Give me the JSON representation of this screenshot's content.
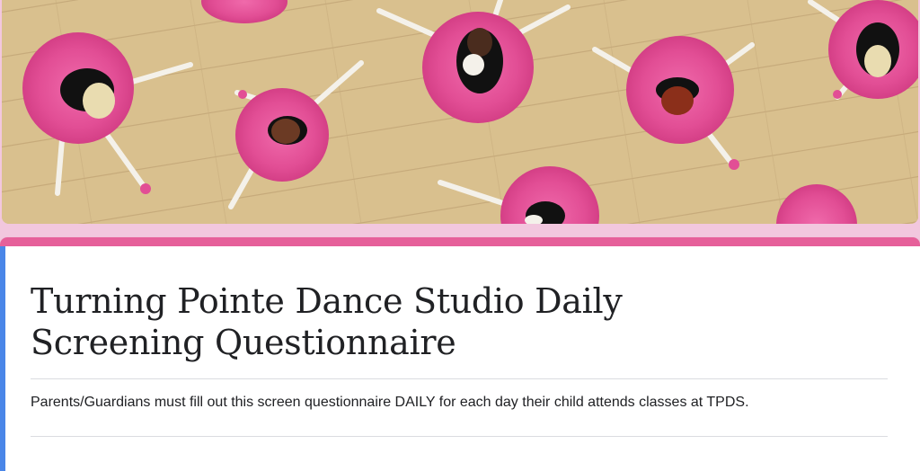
{
  "form": {
    "title": "Turning Pointe Dance Studio Daily Screening Questionnaire",
    "description": "Parents/Guardians must fill out this screen questionnaire DAILY for each day their child attends classes at TPDS."
  },
  "header_image": {
    "subject": "ballerinas in pink tutus on a wooden floor",
    "icon": "header-illustration"
  },
  "colors": {
    "page_background": "#f2c7de",
    "theme_pink": "#e6609a",
    "accent_blue": "#4a86e8",
    "tutu_pink": "#e8529a",
    "floor_wood": "#d9c08e"
  }
}
